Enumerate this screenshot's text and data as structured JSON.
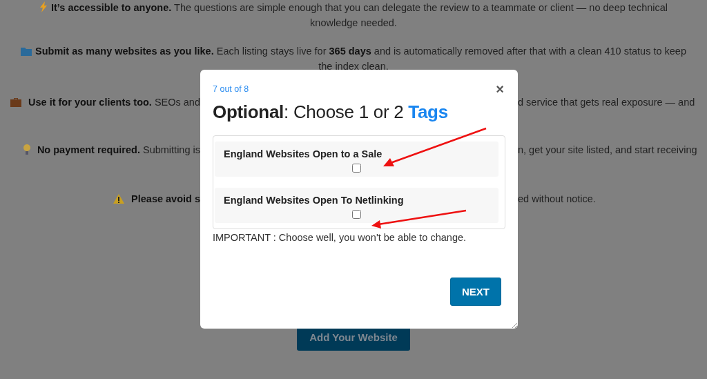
{
  "page": {
    "paragraphs": [
      {
        "kind": "bolt",
        "lines": [
          "**It’s accessible to anyone.** The questions are simple enough that you can delegate the review to a teammate or client — no deep technical",
          "knowledge needed."
        ]
      },
      {
        "kind": "folder",
        "lines": [
          "**Submit as many websites as you like.** Each listing stays live for **365 days** and is automatically removed after that with a clean 410 status to keep",
          "the index clean."
        ]
      }
    ],
    "covered": [
      {
        "kind": "briefcase",
        "left": "**Use it for your clients too.** SEOs and",
        "right": "d service that gets real exposure — and"
      },
      {
        "kind": "bulb",
        "left": "**No payment required.** Submitting is",
        "right": "n, get your site listed, and start receiving"
      },
      {
        "kind": "warning",
        "left": "**Please avoid s**",
        "right": "ed without notice."
      }
    ],
    "button": "Add Your Website"
  },
  "modal": {
    "step": "7 out of 8",
    "close": "×",
    "title": {
      "lead": "Optional",
      "middle": ": Choose 1 or 2 ",
      "accent": "Tags"
    },
    "options": [
      {
        "label": "England Websites Open to a Sale",
        "checked": false
      },
      {
        "label": "England Websites Open To Netlinking",
        "checked": false
      }
    ],
    "note": "IMPORTANT : Choose well, you won't be able to change.",
    "next": "NEXT"
  }
}
